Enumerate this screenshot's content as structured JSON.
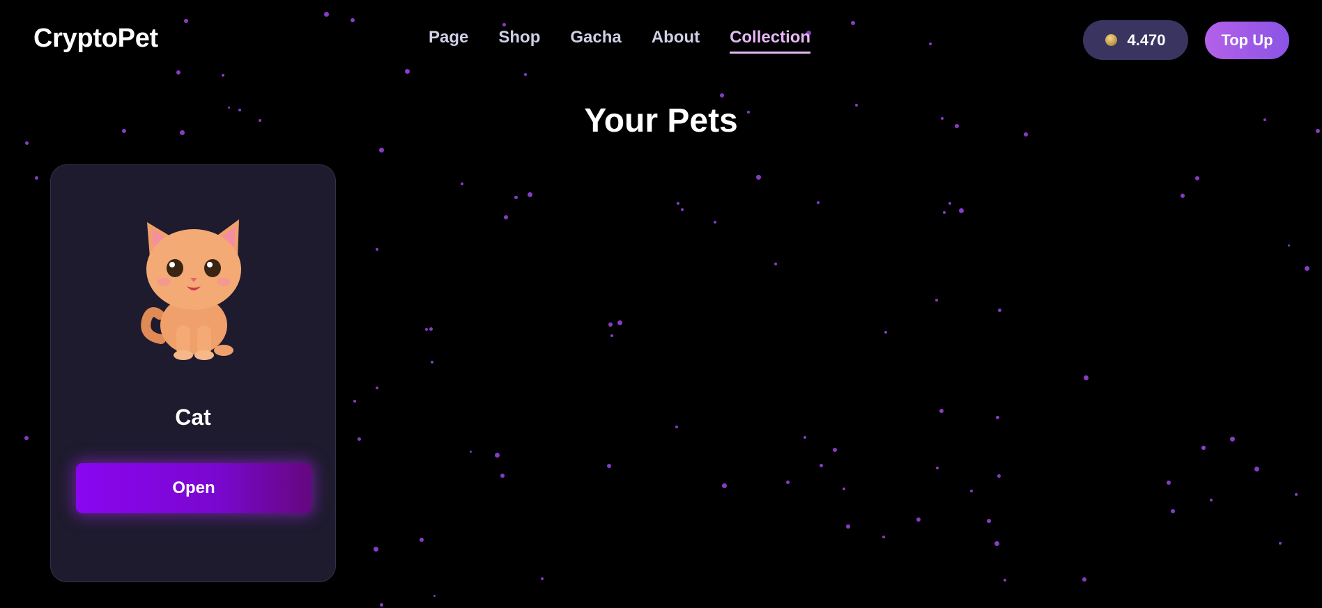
{
  "app": {
    "logo": "CryptoPet"
  },
  "nav": {
    "items": [
      {
        "label": "Page",
        "active": false
      },
      {
        "label": "Shop",
        "active": false
      },
      {
        "label": "Gacha",
        "active": false
      },
      {
        "label": "About",
        "active": false
      },
      {
        "label": "Collection",
        "active": true
      }
    ]
  },
  "wallet": {
    "balance": "4.470",
    "coin_icon": "coin-icon",
    "topup_label": "Top Up"
  },
  "main": {
    "title": "Your Pets",
    "pets": [
      {
        "name": "Cat",
        "image_icon": "cat-illustration",
        "button_label": "Open"
      }
    ]
  },
  "colors": {
    "background": "#000000",
    "accent": "#8a06f0",
    "nav_active": "#e6b8f5",
    "particle": "#8e3fd0",
    "card": "#1e1b2e",
    "balance_pill": "#3a3560"
  }
}
